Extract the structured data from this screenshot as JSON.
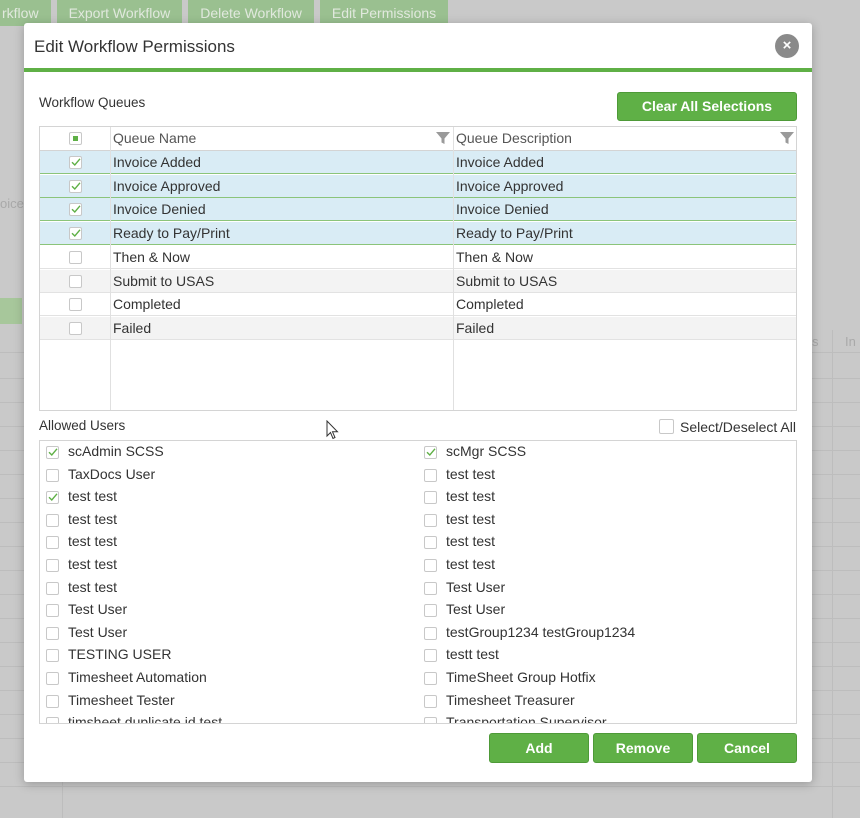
{
  "background": {
    "toolbar_tabs": [
      "rkflow",
      "Export Workflow",
      "Delete Workflow",
      "Edit Permissions"
    ],
    "side_text_1": "oices",
    "side_text_2": "s",
    "side_text_3": "In"
  },
  "dialog": {
    "title": "Edit Workflow Permissions",
    "close_label": "×",
    "queues": {
      "label": "Workflow Queues",
      "clear_button": "Clear All Selections",
      "headers": {
        "name": "Queue Name",
        "description": "Queue Description"
      },
      "rows": [
        {
          "name": "Invoice Added",
          "description": "Invoice Added",
          "checked": true
        },
        {
          "name": "Invoice Approved",
          "description": "Invoice Approved",
          "checked": true
        },
        {
          "name": "Invoice Denied",
          "description": "Invoice Denied",
          "checked": true
        },
        {
          "name": "Ready to Pay/Print",
          "description": "Ready to Pay/Print",
          "checked": true
        },
        {
          "name": "Then & Now",
          "description": "Then & Now",
          "checked": false
        },
        {
          "name": "Submit to USAS",
          "description": "Submit to USAS",
          "checked": false
        },
        {
          "name": "Completed",
          "description": "Completed",
          "checked": false
        },
        {
          "name": "Failed",
          "description": "Failed",
          "checked": false
        }
      ]
    },
    "users": {
      "label": "Allowed Users",
      "select_all_label": "Select/Deselect All",
      "left": [
        {
          "name": "scAdmin SCSS",
          "checked": true
        },
        {
          "name": "TaxDocs User",
          "checked": false
        },
        {
          "name": "test test",
          "checked": true
        },
        {
          "name": "test test",
          "checked": false
        },
        {
          "name": "test test",
          "checked": false
        },
        {
          "name": "test test",
          "checked": false
        },
        {
          "name": "test test",
          "checked": false
        },
        {
          "name": "Test User",
          "checked": false
        },
        {
          "name": "Test User",
          "checked": false
        },
        {
          "name": "TESTING USER",
          "checked": false
        },
        {
          "name": "Timesheet Automation",
          "checked": false
        },
        {
          "name": "Timesheet Tester",
          "checked": false
        },
        {
          "name": "timsheet duplicate id test",
          "checked": false
        }
      ],
      "right": [
        {
          "name": "scMgr SCSS",
          "checked": true
        },
        {
          "name": "test test",
          "checked": false
        },
        {
          "name": "test test",
          "checked": false
        },
        {
          "name": "test test",
          "checked": false
        },
        {
          "name": "test test",
          "checked": false
        },
        {
          "name": "test test",
          "checked": false
        },
        {
          "name": "Test User",
          "checked": false
        },
        {
          "name": "Test User",
          "checked": false
        },
        {
          "name": "testGroup1234 testGroup1234",
          "checked": false
        },
        {
          "name": "testt test",
          "checked": false
        },
        {
          "name": "TimeSheet Group Hotfix",
          "checked": false
        },
        {
          "name": "Timesheet Treasurer",
          "checked": false
        },
        {
          "name": "Transportation Supervisor",
          "checked": false
        }
      ]
    },
    "buttons": {
      "add": "Add",
      "remove": "Remove",
      "cancel": "Cancel"
    }
  },
  "colors": {
    "accent": "#5fb046",
    "selected_row": "#d9ecf5"
  }
}
